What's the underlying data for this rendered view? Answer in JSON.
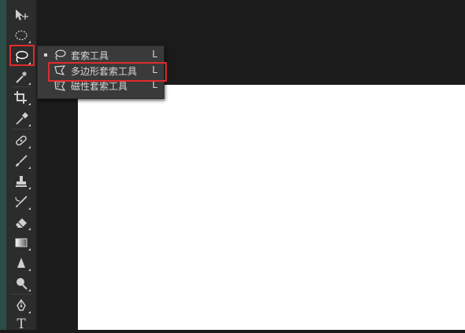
{
  "toolbar": {
    "tools": [
      {
        "name": "move-tool"
      },
      {
        "name": "marquee-tool"
      },
      {
        "name": "lasso-tool",
        "active": true
      },
      {
        "name": "magic-wand-tool"
      },
      {
        "name": "crop-tool"
      },
      {
        "name": "eyedropper-tool"
      },
      {
        "name": "healing-brush-tool"
      },
      {
        "name": "brush-tool"
      },
      {
        "name": "clone-stamp-tool"
      },
      {
        "name": "history-brush-tool"
      },
      {
        "name": "eraser-tool"
      },
      {
        "name": "gradient-tool"
      },
      {
        "name": "blur-tool"
      },
      {
        "name": "dodge-tool"
      },
      {
        "name": "pen-tool"
      },
      {
        "name": "type-tool"
      }
    ],
    "type_tool_label": "T"
  },
  "flyout": {
    "items": [
      {
        "label": "套索工具",
        "shortcut": "L",
        "icon": "lasso-icon",
        "selected": true
      },
      {
        "label": "多边形套索工具",
        "shortcut": "L",
        "icon": "polygonal-lasso-icon",
        "selected": false
      },
      {
        "label": "磁性套索工具",
        "shortcut": "L",
        "icon": "magnetic-lasso-icon",
        "selected": false
      }
    ]
  },
  "colors": {
    "highlight": "#e12b2b",
    "toolbar_bg": "#2c2c2c",
    "flyout_bg": "#3a3a3a",
    "workspace_bg": "#1b1b1b",
    "canvas_bg": "#ffffff"
  }
}
